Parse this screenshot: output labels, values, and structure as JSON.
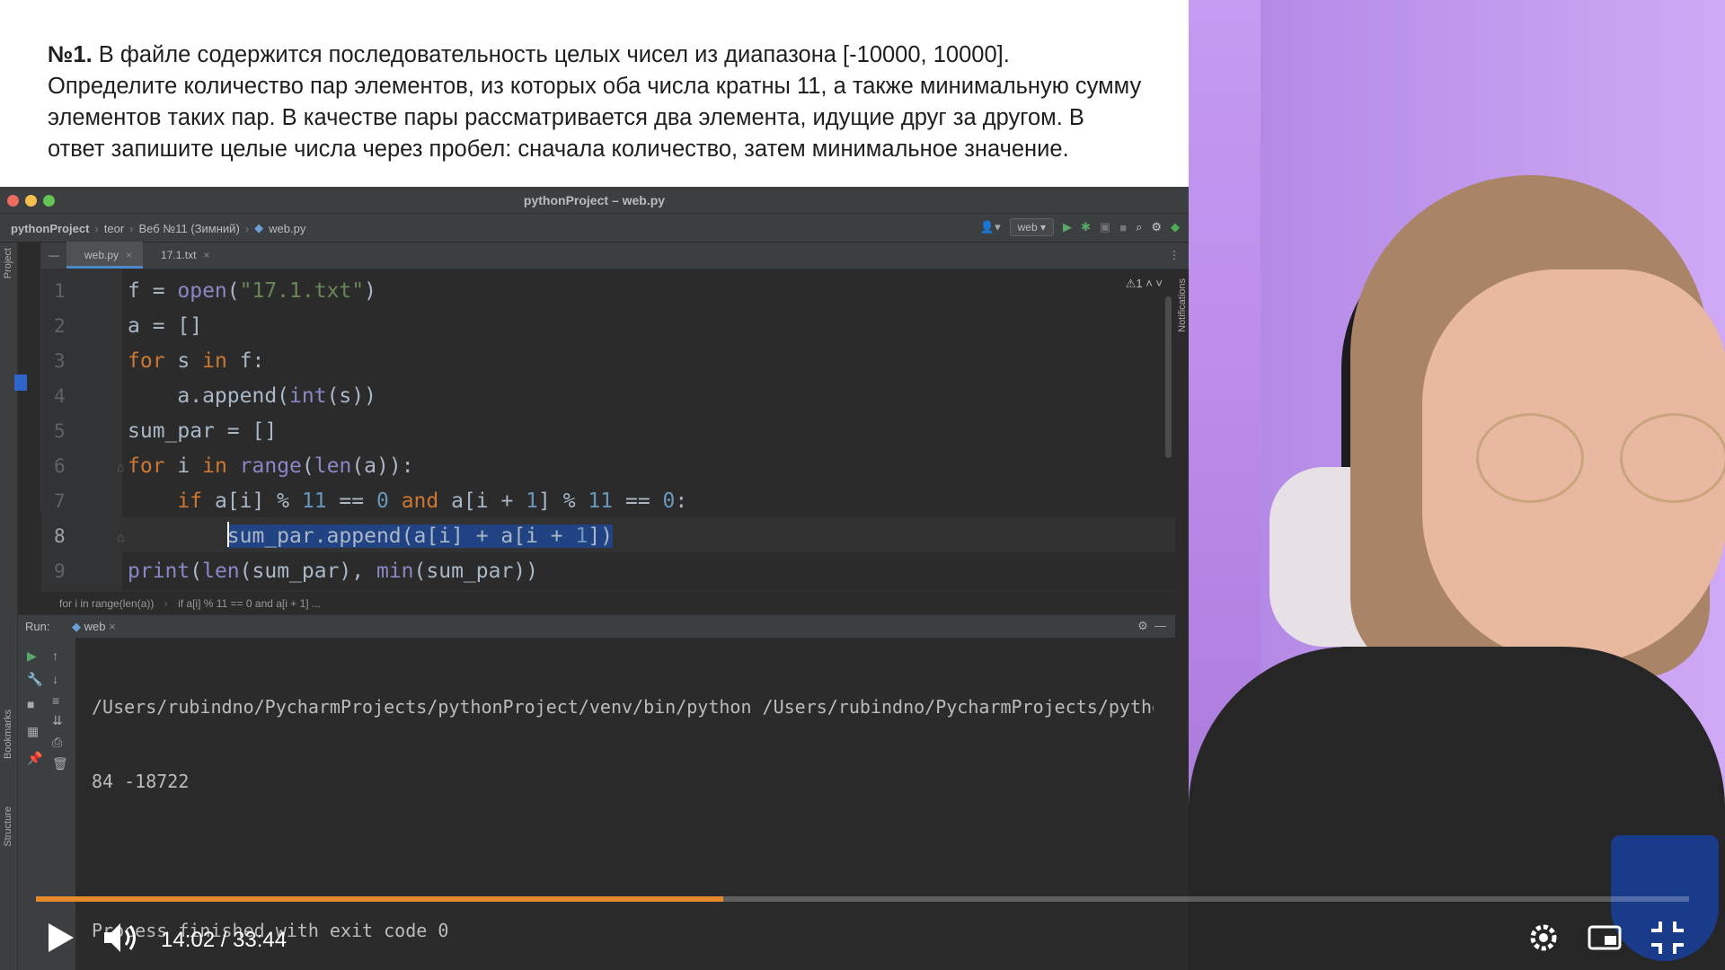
{
  "task": {
    "number": "№1.",
    "text": "В файле содержится последовательность целых чисел из диапазона [-10000, 10000]. Определите количество пар элементов, из которых оба числа кратны 11, а также минимальную сумму элементов таких пар. В качестве пары рассматривается два элемента, идущие друг за другом. В ответ запишите целые числа через пробел: сначала количество, затем минимальное значение."
  },
  "ide": {
    "window_title": "pythonProject – web.py",
    "breadcrumbs": [
      "pythonProject",
      "teor",
      "Веб №11 (Зимний)",
      "web.py"
    ],
    "run_config": "web",
    "tabs": [
      {
        "label": "web.py",
        "active": true
      },
      {
        "label": "17.1.txt",
        "active": false
      }
    ],
    "warning_count": "⚠1",
    "side_labels": {
      "project": "Project",
      "notifications": "Notifications",
      "bookmarks": "Bookmarks",
      "structure": "Structure"
    },
    "editor_breadcrumbs": [
      "for i in range(len(a))",
      "if a[i] % 11 == 0 and a[i + 1] ..."
    ],
    "current_line": 8,
    "line_numbers": [
      "1",
      "2",
      "3",
      "4",
      "5",
      "6",
      "7",
      "8",
      "9"
    ],
    "code_lines": [
      "f = open(\"17.1.txt\")",
      "a = []",
      "for s in f:",
      "    a.append(int(s))",
      "sum_par = []",
      "for i in range(len(a)):",
      "    if a[i] % 11 == 0 and a[i + 1] % 11 == 0:",
      "        sum_par.append(a[i] + a[i + 1])",
      "print(len(sum_par), min(sum_par))"
    ],
    "run_panel": {
      "label": "Run:",
      "tab": "web",
      "console_lines": [
        "/Users/rubindno/PycharmProjects/pythonProject/venv/bin/python /Users/rubindno/PycharmProjects/pytho",
        "84 -18722",
        "",
        "Process finished with exit code 0"
      ]
    }
  },
  "player": {
    "current_time": "14:02",
    "total_time": "33:44",
    "time_display": "14:02 / 33:44",
    "progress_fraction": 0.4158,
    "accent_color": "#e58a2a"
  },
  "icons": [
    "play-icon",
    "volume-icon",
    "settings-gear-icon",
    "miniplayer-icon",
    "exit-fullscreen-icon"
  ]
}
